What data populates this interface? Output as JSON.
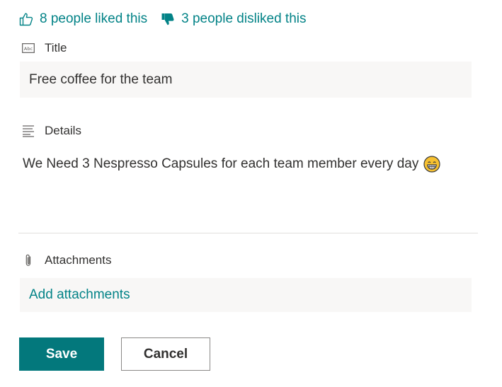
{
  "reactions": {
    "likes_text": "8 people liked this",
    "dislikes_text": "3 people disliked this"
  },
  "fields": {
    "title": {
      "label": "Title",
      "value": "Free coffee for the team"
    },
    "details": {
      "label": "Details",
      "value": "We Need 3 Nespresso Capsules for each team member every day"
    },
    "attachments": {
      "label": "Attachments",
      "add_link": "Add attachments"
    }
  },
  "actions": {
    "save_label": "Save",
    "cancel_label": "Cancel"
  },
  "colors": {
    "accent": "#038387",
    "primary_button": "#03787c",
    "input_background": "#f8f7f6",
    "text": "#323130"
  },
  "icons": {
    "like": "thumbs-up-outline-icon",
    "dislike": "thumbs-down-filled-icon",
    "title": "text-field-icon",
    "details": "multiline-text-icon",
    "attachments": "paperclip-icon",
    "emoji": "grinning-face-emoji"
  }
}
